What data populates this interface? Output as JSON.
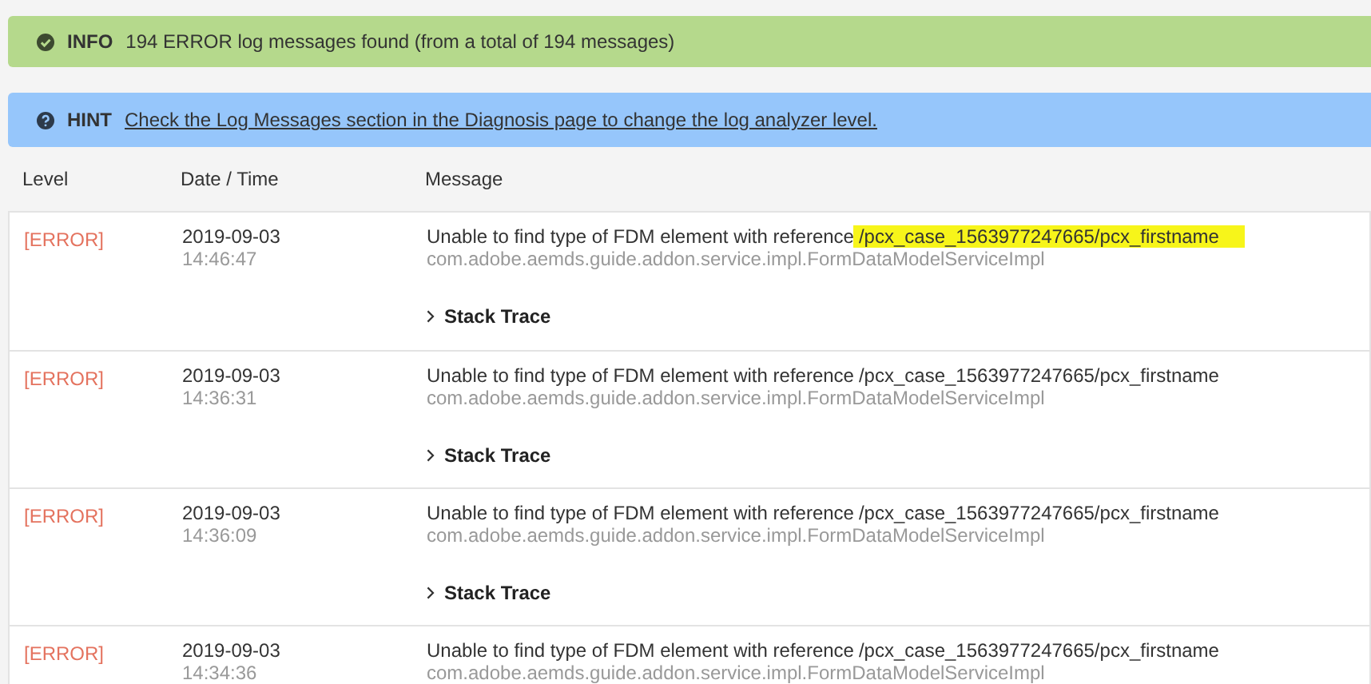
{
  "info_banner": {
    "label": "INFO",
    "text": "194 ERROR log messages found (from a total of 194 messages)"
  },
  "hint_banner": {
    "label": "HINT",
    "link": "Check the Log Messages section in the Diagnosis page to change the log analyzer level."
  },
  "table": {
    "columns": [
      "Level",
      "Date / Time",
      "Message"
    ],
    "rows": [
      {
        "level": "[ERROR]",
        "date": "2019-09-03",
        "time": "14:46:47",
        "message": "Unable to find type of FDM element with reference",
        "reference": "/pcx_case_1563977247665/pcx_firstname",
        "highlighted": true,
        "source": "com.adobe.aemds.guide.addon.service.impl.FormDataModelServiceImpl",
        "toggle": "Stack Trace"
      },
      {
        "level": "[ERROR]",
        "date": "2019-09-03",
        "time": "14:36:31",
        "message": "Unable to find type of FDM element with reference",
        "reference": "/pcx_case_1563977247665/pcx_firstname",
        "highlighted": false,
        "source": "com.adobe.aemds.guide.addon.service.impl.FormDataModelServiceImpl",
        "toggle": "Stack Trace"
      },
      {
        "level": "[ERROR]",
        "date": "2019-09-03",
        "time": "14:36:09",
        "message": "Unable to find type of FDM element with reference",
        "reference": "/pcx_case_1563977247665/pcx_firstname",
        "highlighted": false,
        "source": "com.adobe.aemds.guide.addon.service.impl.FormDataModelServiceImpl",
        "toggle": "Stack Trace"
      },
      {
        "level": "[ERROR]",
        "date": "2019-09-03",
        "time": "14:34:36",
        "message": "Unable to find type of FDM element with reference",
        "reference": "/pcx_case_1563977247665/pcx_firstname",
        "highlighted": false,
        "source": "com.adobe.aemds.guide.addon.service.impl.FormDataModelServiceImpl"
      }
    ]
  }
}
